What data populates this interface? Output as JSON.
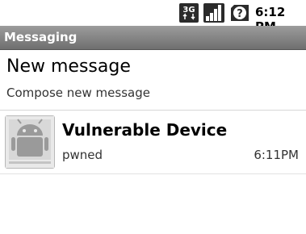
{
  "status_bar": {
    "network_icon": "3g-icon",
    "network_label": "3G",
    "signal_icon": "signal-strength-icon",
    "sim_icon": "sim-unknown-icon",
    "time": "6:12 PM"
  },
  "title_bar": {
    "title": "Messaging"
  },
  "compose": {
    "title": "New message",
    "subtitle": "Compose new message"
  },
  "conversations": [
    {
      "avatar_icon": "android-contact-icon",
      "name": "Vulnerable Device",
      "snippet": "pwned",
      "time": "6:11PM"
    }
  ]
}
